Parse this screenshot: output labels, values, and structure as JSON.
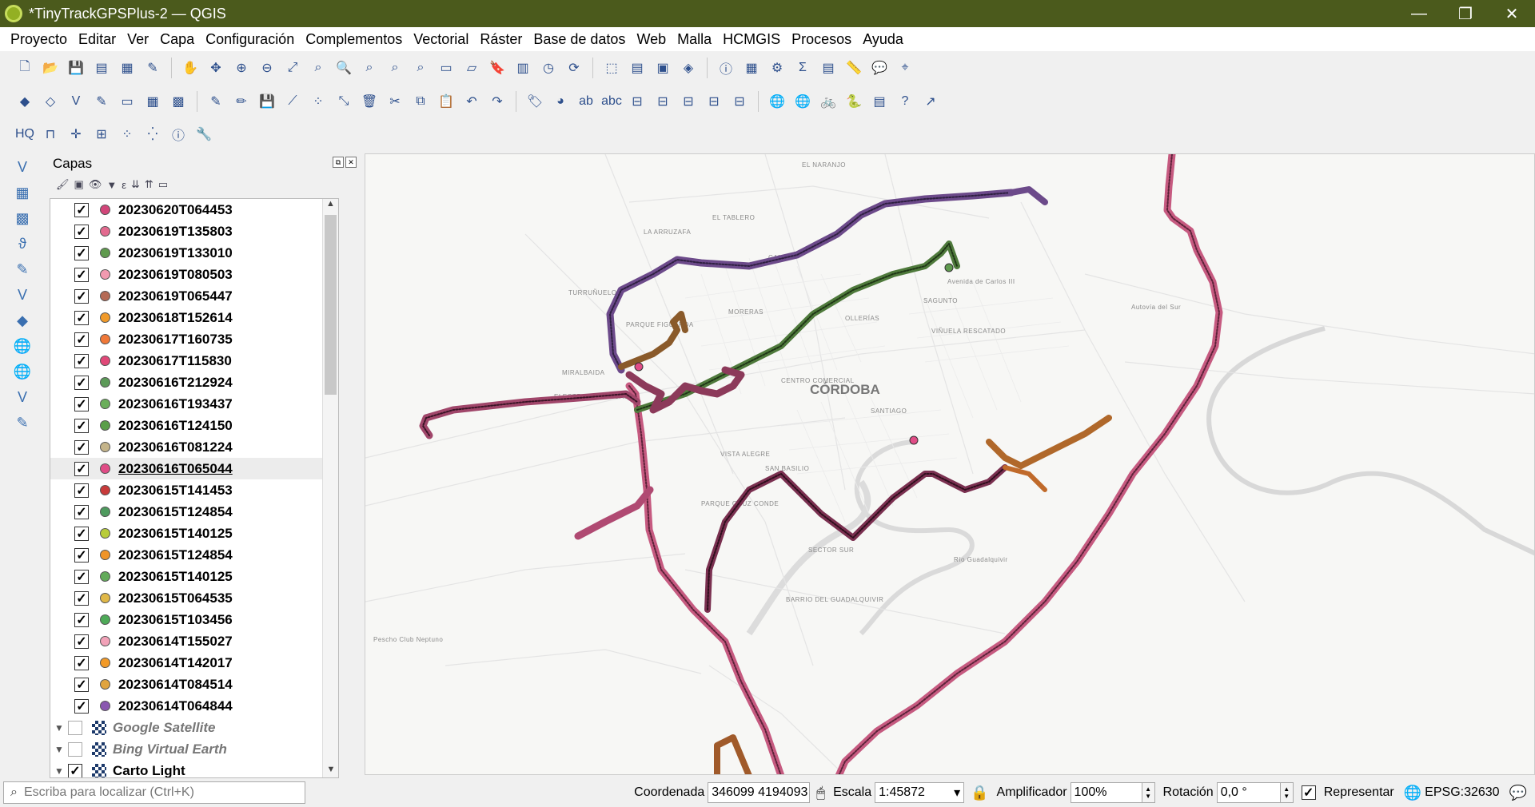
{
  "window": {
    "title": "*TinyTrackGPSPlus-2 — QGIS",
    "min": "—",
    "max": "❐",
    "close": "✕"
  },
  "menu": [
    "Proyecto",
    "Editar",
    "Ver",
    "Capa",
    "Configuración",
    "Complementos",
    "Vectorial",
    "Ráster",
    "Base de datos",
    "Web",
    "Malla",
    "HCMGIS",
    "Procesos",
    "Ayuda"
  ],
  "layers_panel": {
    "title": "Capas",
    "layers": [
      {
        "name": "20230620T064453",
        "color": "#d2467a",
        "checked": true
      },
      {
        "name": "20230619T135803",
        "color": "#e36a8f",
        "checked": true
      },
      {
        "name": "20230619T133010",
        "color": "#5f9a4e",
        "checked": true
      },
      {
        "name": "20230619T080503",
        "color": "#f19ab0",
        "checked": true
      },
      {
        "name": "20230619T065447",
        "color": "#b46a55",
        "checked": true
      },
      {
        "name": "20230618T152614",
        "color": "#f09a2a",
        "checked": true
      },
      {
        "name": "20230617T160735",
        "color": "#f07838",
        "checked": true
      },
      {
        "name": "20230617T115830",
        "color": "#e04878",
        "checked": true
      },
      {
        "name": "20230616T212924",
        "color": "#5c9a58",
        "checked": true
      },
      {
        "name": "20230616T193437",
        "color": "#6aae5a",
        "checked": true
      },
      {
        "name": "20230616T124150",
        "color": "#5a9e4a",
        "checked": true
      },
      {
        "name": "20230616T081224",
        "color": "#c4b48a",
        "checked": true
      },
      {
        "name": "20230616T065044",
        "color": "#e04c86",
        "checked": true,
        "selected": true
      },
      {
        "name": "20230615T141453",
        "color": "#c83a3a",
        "checked": true
      },
      {
        "name": "20230615T124854",
        "color": "#4e9a5e",
        "checked": true
      },
      {
        "name": "20230615T140125",
        "color": "#b8cc3a",
        "checked": true
      },
      {
        "name": "20230615T124854",
        "color": "#f09428",
        "checked": true
      },
      {
        "name": "20230615T140125",
        "color": "#62aa5a",
        "checked": true
      },
      {
        "name": "20230615T064535",
        "color": "#e0b848",
        "checked": true
      },
      {
        "name": "20230615T103456",
        "color": "#4eaa58",
        "checked": true
      },
      {
        "name": "20230614T155027",
        "color": "#f2a2b8",
        "checked": true
      },
      {
        "name": "20230614T142017",
        "color": "#f29a28",
        "checked": true
      },
      {
        "name": "20230614T084514",
        "color": "#e0a440",
        "checked": true
      },
      {
        "name": "20230614T064844",
        "color": "#8a58b0",
        "checked": true
      }
    ],
    "basemaps": [
      {
        "name": "Google Satellite",
        "checked": false
      },
      {
        "name": "Bing Virtual Earth",
        "checked": false
      },
      {
        "name": "Carto Light",
        "checked": true
      }
    ]
  },
  "map": {
    "labels": [
      "EL NARANJO",
      "EL TABLERO",
      "LA ARRUZAFA",
      "CAMPO",
      "TURRUÑUELOS",
      "PARQUE FIGUEROA",
      "MORERAS",
      "OLLERÍAS",
      "SAGUNTO",
      "VIÑUELA RESCATADO",
      "MIRALBAIDA",
      "ELECTROMECÁNICAS",
      "CENTRO COMERCIAL",
      "CÓRDOBA",
      "SANTIAGO",
      "VISTA ALEGRE",
      "SAN BASILIO",
      "PARQUE CRUZ CONDE",
      "SECTOR SUR",
      "BARRIO DEL GUADALQUIVIR",
      "Avenida de Carlos III",
      "Autovía del Sur",
      "Río Guadalquivir",
      "Pescho Club Neptuno"
    ]
  },
  "status": {
    "locator_placeholder": "Escriba para localizar (Ctrl+K)",
    "coord_label": "Coordenada",
    "coord_value": "346099  4194093",
    "scale_label": "Escala",
    "scale_value": "1:45872",
    "magnifier_label": "Amplificador",
    "magnifier_value": "100%",
    "rotation_label": "Rotación",
    "rotation_value": "0,0 °",
    "render_label": "Representar",
    "crs": "EPSG:32630"
  }
}
